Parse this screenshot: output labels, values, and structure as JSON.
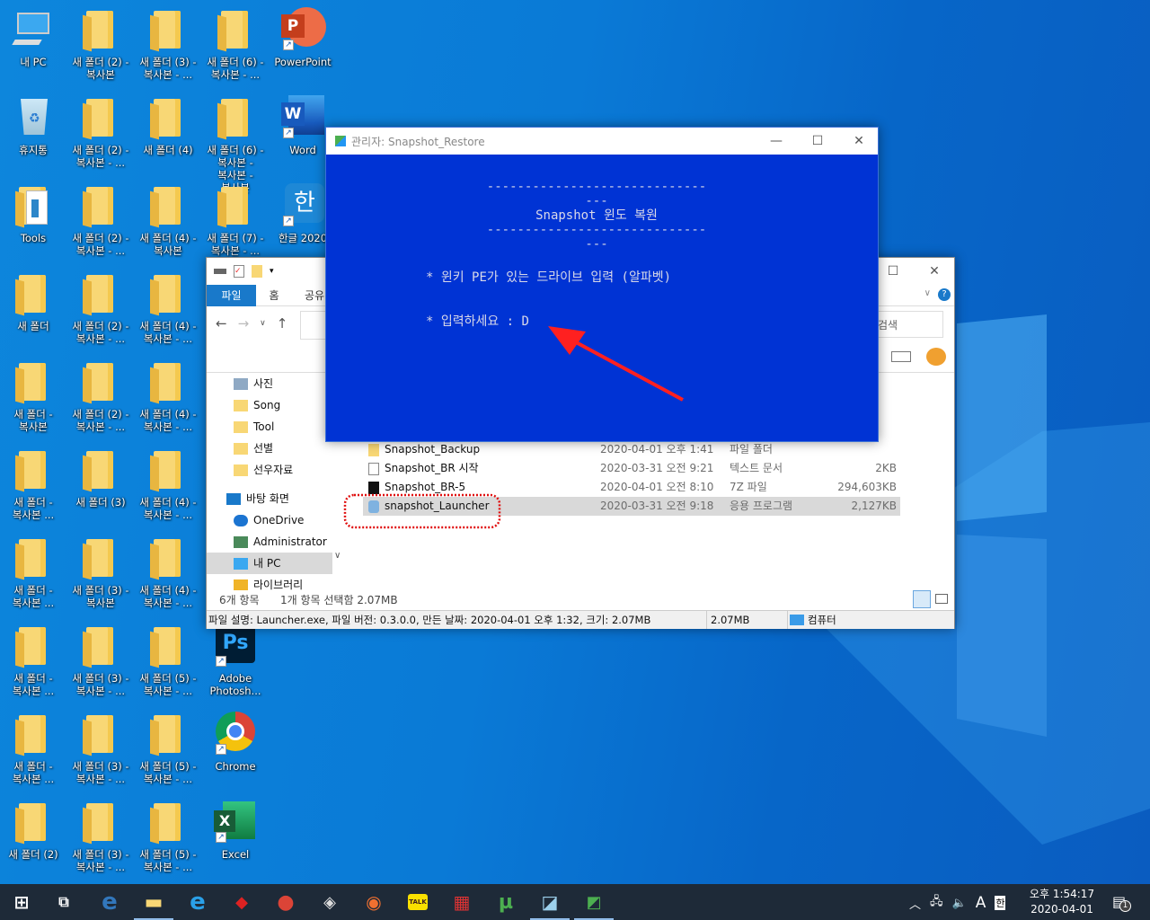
{
  "desktop": {
    "icons": [
      {
        "col": 0,
        "row": 0,
        "label": "내 PC",
        "icon": "pc-icon"
      },
      {
        "col": 0,
        "row": 1,
        "label": "휴지통",
        "icon": "recycle-bin-icon"
      },
      {
        "col": 0,
        "row": 2,
        "label": "Tools",
        "icon": "folder-docs-icon"
      },
      {
        "col": 0,
        "row": 3,
        "label": "새 폴더",
        "icon": "folder-icon"
      },
      {
        "col": 0,
        "row": 4,
        "label": "새 폴더 - 복사본",
        "icon": "folder-icon"
      },
      {
        "col": 0,
        "row": 5,
        "label": "새 폴더 - 복사본 ...",
        "icon": "folder-icon"
      },
      {
        "col": 0,
        "row": 6,
        "label": "새 폴더 - 복사본 ...",
        "icon": "folder-icon"
      },
      {
        "col": 0,
        "row": 7,
        "label": "새 폴더 - 복사본 ...",
        "icon": "folder-icon"
      },
      {
        "col": 0,
        "row": 8,
        "label": "새 폴더 - 복사본 ...",
        "icon": "folder-icon"
      },
      {
        "col": 0,
        "row": 9,
        "label": "새 폴더 (2)",
        "icon": "folder-icon"
      },
      {
        "col": 1,
        "row": 0,
        "label": "새 폴더 (2) - 복사본",
        "icon": "folder-icon"
      },
      {
        "col": 1,
        "row": 1,
        "label": "새 폴더 (2) - 복사본 - ...",
        "icon": "folder-icon"
      },
      {
        "col": 1,
        "row": 2,
        "label": "새 폴더 (2) - 복사본 - ...",
        "icon": "folder-icon"
      },
      {
        "col": 1,
        "row": 3,
        "label": "새 폴더 (2) - 복사본 - ...",
        "icon": "folder-icon"
      },
      {
        "col": 1,
        "row": 4,
        "label": "새 폴더 (2) - 복사본 - ...",
        "icon": "folder-icon"
      },
      {
        "col": 1,
        "row": 5,
        "label": "새 폴더 (3)",
        "icon": "folder-icon"
      },
      {
        "col": 1,
        "row": 6,
        "label": "새 폴더 (3) - 복사본",
        "icon": "folder-icon"
      },
      {
        "col": 1,
        "row": 7,
        "label": "새 폴더 (3) - 복사본 - ...",
        "icon": "folder-icon"
      },
      {
        "col": 1,
        "row": 8,
        "label": "새 폴더 (3) - 복사본 - ...",
        "icon": "folder-icon"
      },
      {
        "col": 1,
        "row": 9,
        "label": "새 폴더 (3) - 복사본 - ...",
        "icon": "folder-icon"
      },
      {
        "col": 2,
        "row": 0,
        "label": "새 폴더 (3) - 복사본 - ...",
        "icon": "folder-icon"
      },
      {
        "col": 2,
        "row": 1,
        "label": "새 폴더 (4)",
        "icon": "folder-icon"
      },
      {
        "col": 2,
        "row": 2,
        "label": "새 폴더 (4) - 복사본",
        "icon": "folder-icon"
      },
      {
        "col": 2,
        "row": 3,
        "label": "새 폴더 (4) - 복사본 - ...",
        "icon": "folder-icon"
      },
      {
        "col": 2,
        "row": 4,
        "label": "새 폴더 (4) - 복사본 - ...",
        "icon": "folder-icon"
      },
      {
        "col": 2,
        "row": 5,
        "label": "새 폴더 (4) - 복사본 - ...",
        "icon": "folder-icon"
      },
      {
        "col": 2,
        "row": 6,
        "label": "새 폴더 (4) - 복사본 - ...",
        "icon": "folder-icon"
      },
      {
        "col": 2,
        "row": 7,
        "label": "새 폴더 (5) - 복사본 - ...",
        "icon": "folder-icon"
      },
      {
        "col": 2,
        "row": 8,
        "label": "새 폴더 (5) - 복사본 - ...",
        "icon": "folder-icon"
      },
      {
        "col": 2,
        "row": 9,
        "label": "새 폴더 (5) - 복사본 - ...",
        "icon": "folder-icon"
      },
      {
        "col": 3,
        "row": 0,
        "label": "새 폴더 (6) - 복사본 - ...",
        "icon": "folder-icon"
      },
      {
        "col": 3,
        "row": 1,
        "label": "새 폴더 (6) - 복사본 - 복사본 - 복사본",
        "icon": "folder-icon"
      },
      {
        "col": 3,
        "row": 2,
        "label": "새 폴더 (7) - 복사본 - ...",
        "icon": "folder-icon"
      },
      {
        "col": 3,
        "row": 7,
        "label": "Adobe Photosh...",
        "icon": "photoshop-icon"
      },
      {
        "col": 3,
        "row": 8,
        "label": "Chrome",
        "icon": "chrome-icon"
      },
      {
        "col": 3,
        "row": 9,
        "label": "Excel",
        "icon": "excel-icon"
      },
      {
        "col": 4,
        "row": 0,
        "label": "PowerPoint",
        "icon": "powerpoint-icon"
      },
      {
        "col": 4,
        "row": 1,
        "label": "Word",
        "icon": "word-icon"
      },
      {
        "col": 4,
        "row": 2,
        "label": "한글 2020",
        "icon": "hangul-icon"
      }
    ]
  },
  "console": {
    "title": "관리자:  Snapshot_Restore",
    "dashes": "--------------------------------",
    "heading": "Snapshot 윈도 복원",
    "line1": "* 윈키 PE가 있는 드라이브 입력 (알파벳)",
    "line2": "* 입력하세요 : D",
    "bg": "#0033d4"
  },
  "explorer": {
    "tabs": [
      "파일",
      "홈",
      "공유"
    ],
    "search_placeholder": "검색",
    "nav": [
      "사진",
      "Song",
      "Tool",
      "선별",
      "선우자료",
      "바탕 화면",
      "OneDrive",
      "Administrator",
      "내 PC",
      "라이브러리"
    ],
    "files": [
      {
        "name": "Snapshot_Backup",
        "date": "2020-04-01 오후 1:41",
        "type": "파일 폴더",
        "size": "",
        "icon": "folder-icon"
      },
      {
        "name": "Snapshot_BR 시작",
        "date": "2020-03-31 오전 9:21",
        "type": "텍스트 문서",
        "size": "2KB",
        "icon": "text-file-icon"
      },
      {
        "name": "Snapshot_BR-5",
        "date": "2020-04-01 오전 8:10",
        "type": "7Z 파일",
        "size": "294,603KB",
        "icon": "7z-icon"
      },
      {
        "name": "snapshot_Launcher",
        "date": "2020-03-31 오전 9:18",
        "type": "응용 프로그램",
        "size": "2,127KB",
        "icon": "app-icon",
        "selected": true
      }
    ],
    "status_count": "6개 항목",
    "status_selected": "1개 항목 선택함 2.07MB",
    "details": "파일 설명: Launcher.exe, 파일 버전: 0.3.0.0, 만든 날짜: 2020-04-01 오후 1:32, 크기: 2.07MB",
    "details_size": "2.07MB",
    "details_location": "컴퓨터"
  },
  "taskbar": {
    "time": "오후 1:54:17",
    "date": "2020-04-01",
    "ime_lang": "A",
    "ime_mode": "한",
    "notification_count": "1",
    "apps": [
      "start-icon",
      "task-view-icon",
      "edge-icon",
      "file-explorer-icon",
      "internet-explorer-icon",
      "app-icon",
      "chrome-icon",
      "tool-icon",
      "eye-icon",
      "kakaotalk-icon",
      "grid-app-icon",
      "utorrent-icon",
      "snapshot-icon",
      "console-app-icon"
    ],
    "kakao_label": "TALK"
  }
}
